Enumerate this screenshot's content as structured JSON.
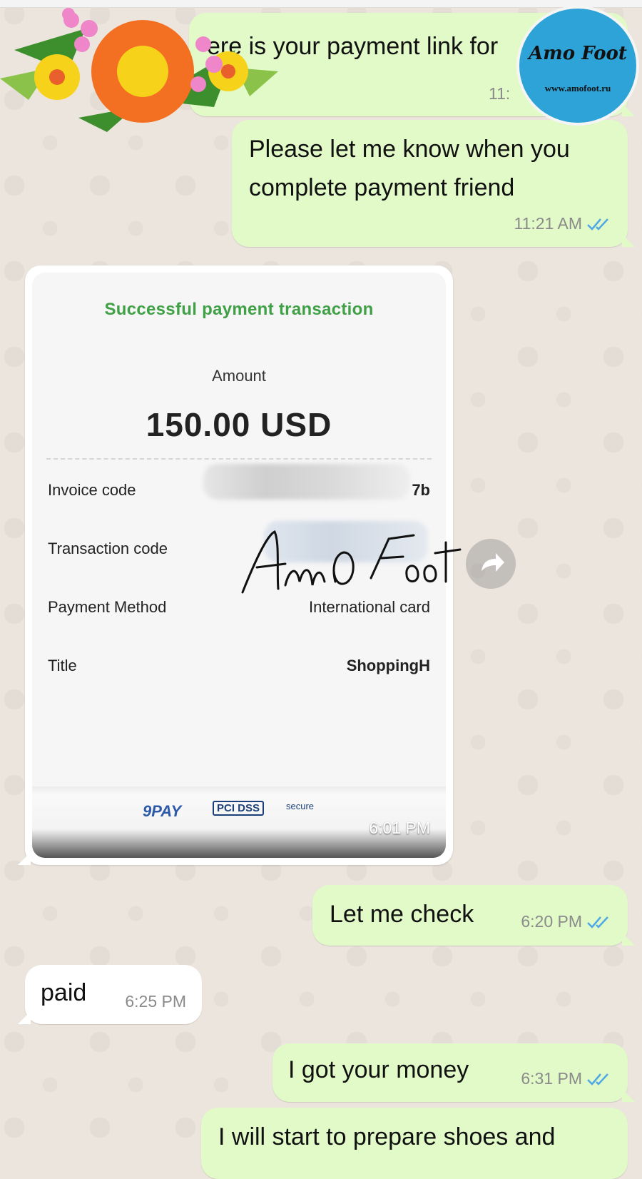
{
  "colors": {
    "outgoing_bubble": "#E1FAC8",
    "incoming_bubble": "#FFFFFF",
    "chat_background": "#ECE5DD",
    "read_ticks": "#4FA8E6",
    "receipt_title": "#3FA046"
  },
  "messages": [
    {
      "dir": "out",
      "text": "ere is your payment link for",
      "time": "11:"
    },
    {
      "dir": "out",
      "text": "Please let me know when you complete payment friend",
      "time": "11:21 AM"
    },
    {
      "dir": "out",
      "text": "Let me check",
      "time": "6:20 PM"
    },
    {
      "dir": "in",
      "text": "paid",
      "time": "6:25 PM"
    },
    {
      "dir": "out",
      "text": "I got your money",
      "time": "6:31 PM"
    },
    {
      "dir": "out",
      "text": "I will start to prepare shoes and"
    }
  ],
  "receipt": {
    "title": "Successful payment transaction",
    "amount_label": "Amount",
    "amount": "150.00 USD",
    "rows": [
      {
        "label": "Invoice code",
        "value": "7b"
      },
      {
        "label": "Transaction code",
        "value": ""
      },
      {
        "label": "Payment Method",
        "value": "International card"
      },
      {
        "label": "Title",
        "value": "ShoppingH"
      }
    ],
    "footer_logos": [
      "9PAY",
      "PCI DSS",
      "secure"
    ],
    "time": "6:01 PM"
  },
  "watermark": {
    "signature_text": "AmO Foot",
    "logo_text": "Amo Foot",
    "logo_url": "www.amofoot.ru"
  },
  "icons": [
    "forward-icon",
    "double-check-icon",
    "flower-sticker"
  ]
}
